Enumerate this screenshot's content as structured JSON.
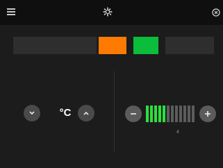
{
  "topbar": {
    "menu_icon": "hamburger-menu-icon",
    "center_icon": "gear-icon",
    "close_icon": "close-icon"
  },
  "color_strip": {
    "segments": [
      {
        "name": "left",
        "color": "#2e2e2e"
      },
      {
        "name": "orange",
        "color": "#ff7a00"
      },
      {
        "name": "green",
        "color": "#0bbd3a"
      },
      {
        "name": "right",
        "color": "#2e2e2e"
      }
    ]
  },
  "temperature": {
    "unit": "°C",
    "decrease_icon": "chevron-down-icon",
    "increase_icon": "chevron-up-icon"
  },
  "fan": {
    "level": 4,
    "segments_total": 12,
    "segments_on": 5,
    "level_label": "4",
    "minus_icon": "minus-icon",
    "plus_icon": "plus-icon",
    "on_color": "#2ddf3e",
    "off_color": "#5c5c5c"
  }
}
